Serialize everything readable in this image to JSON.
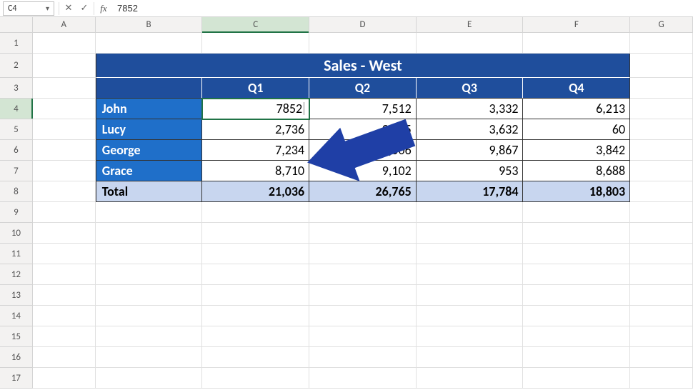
{
  "formula_bar": {
    "name_box": "C4",
    "cancel_icon": "✕",
    "confirm_icon": "✓",
    "fx_label": "fx",
    "value": "7852"
  },
  "columns": [
    "A",
    "B",
    "C",
    "D",
    "E",
    "F",
    "G"
  ],
  "title": "Sales - West",
  "quarters": [
    "Q1",
    "Q2",
    "Q3",
    "Q4"
  ],
  "rows": [
    {
      "name": "John",
      "q1": "7852",
      "q2": "7,512",
      "q3": "3,332",
      "q4": "6,213"
    },
    {
      "name": "Lucy",
      "q1": "2,736",
      "q2": "9,645",
      "q3": "3,632",
      "q4": "60"
    },
    {
      "name": "George",
      "q1": "7,234",
      "q2": "7,506",
      "q3": "9,867",
      "q4": "3,842"
    },
    {
      "name": "Grace",
      "q1": "8,710",
      "q2": "9,102",
      "q3": "953",
      "q4": "8,688"
    }
  ],
  "total": {
    "name": "Total",
    "q1": "21,036",
    "q2": "26,765",
    "q3": "17,784",
    "q4": "18,803"
  },
  "active_cell": "C4",
  "row_numbers": [
    1,
    2,
    3,
    4,
    5,
    6,
    7,
    8,
    9,
    10,
    11,
    12,
    13,
    14,
    15,
    16,
    17
  ],
  "annotation_arrow_color": "#1f3fa6"
}
